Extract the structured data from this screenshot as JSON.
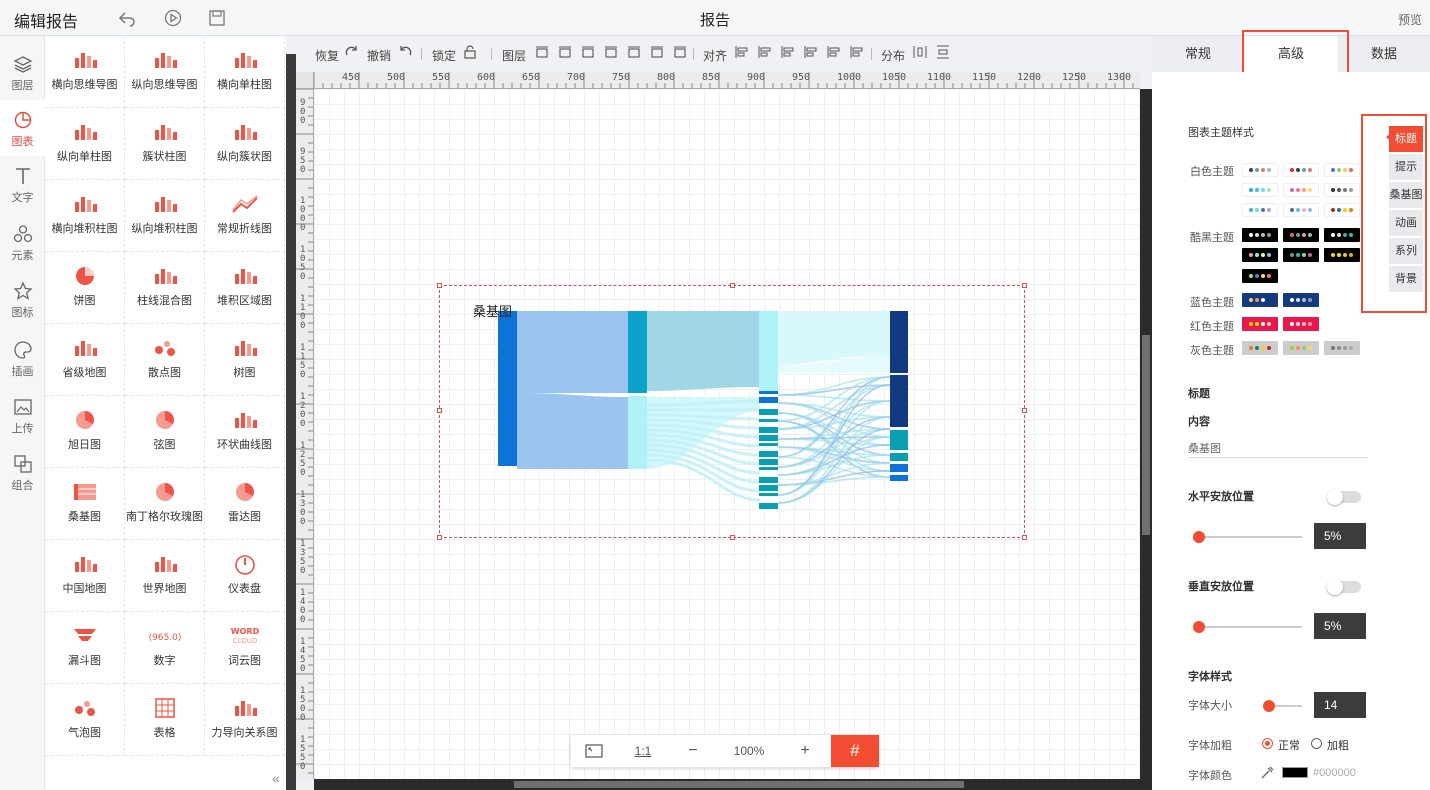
{
  "header": {
    "app_title": "编辑报告",
    "doc_title": "报告",
    "preview": "预览",
    "icons": [
      "undo-icon",
      "play-icon",
      "save-icon"
    ]
  },
  "leftnav": [
    {
      "label": "图层",
      "icon": "layers-icon"
    },
    {
      "label": "图表",
      "icon": "chart-pie-icon",
      "active": true
    },
    {
      "label": "文字",
      "icon": "text-icon"
    },
    {
      "label": "元素",
      "icon": "shapes-icon"
    },
    {
      "label": "图标",
      "icon": "star-icon"
    },
    {
      "label": "插画",
      "icon": "palette-icon"
    },
    {
      "label": "上传",
      "icon": "upload-image-icon"
    },
    {
      "label": "组合",
      "icon": "group-icon"
    }
  ],
  "palette": [
    "横向思维导图",
    "纵向思维导图",
    "横向单柱图",
    "纵向单柱图",
    "簇状柱图",
    "纵向簇状图",
    "横向堆积柱图",
    "纵向堆积柱图",
    "常规折线图",
    "饼图",
    "柱线混合图",
    "堆积区域图",
    "省级地图",
    "散点图",
    "树图",
    "旭日图",
    "弦图",
    "环状曲线图",
    "桑基图",
    "南丁格尔玫瑰图",
    "雷达图",
    "中国地图",
    "世界地图",
    "仪表盘",
    "漏斗图",
    "数字",
    "词云图",
    "气泡图",
    "表格",
    "力导向关系图"
  ],
  "toolbar": {
    "redo": "恢复",
    "undo": "撤销",
    "lock": "锁定",
    "layer": "图层",
    "align": "对齐",
    "distribute": "分布"
  },
  "ruler": {
    "top": [
      "450",
      "500",
      "550",
      "600",
      "650",
      "700",
      "750",
      "800",
      "850",
      "900",
      "950",
      "1000",
      "1050",
      "1100",
      "1150",
      "1200",
      "1250",
      "1300"
    ],
    "left": [
      "900",
      "950",
      "1000",
      "1050",
      "1100",
      "1150",
      "1200",
      "1250",
      "1300",
      "1350",
      "1400",
      "1450",
      "1500",
      "1550"
    ]
  },
  "chart_data": {
    "type": "sankey",
    "title": "桑基图",
    "colors": [
      "#0d73d6",
      "#9cc4f0",
      "#0ba3c9",
      "#aef1f7",
      "#113a80",
      "#089fb0"
    ]
  },
  "zoom": {
    "fit": "fit-screen-icon",
    "one_to_one": "1:1",
    "minus": "−",
    "level": "100%",
    "plus": "+",
    "grid": "#"
  },
  "panel": {
    "tabs": [
      "常规",
      "高级",
      "数据"
    ],
    "active_tab": "高级",
    "theme_heading": "图表主题样式",
    "theme_groups": [
      {
        "label": "白色主题"
      },
      {
        "label": "酷黑主题"
      },
      {
        "label": "蓝色主题"
      },
      {
        "label": "红色主题"
      },
      {
        "label": "灰色主题"
      }
    ],
    "side_tabs": [
      "标题",
      "提示",
      "桑基图",
      "动画",
      "系列",
      "背景"
    ],
    "title_heading": "标题",
    "content_label": "内容",
    "content_value": "桑基图",
    "h_position_label": "水平安放位置",
    "h_position_value": "5%",
    "v_position_label": "垂直安放位置",
    "v_position_value": "5%",
    "font_style_heading": "字体样式",
    "font_size_label": "字体大小",
    "font_size_value": "14",
    "font_weight_label": "字体加粗",
    "font_weight_normal": "正常",
    "font_weight_bold": "加粗",
    "font_color_label": "字体颜色",
    "font_color_value": "#000000"
  }
}
